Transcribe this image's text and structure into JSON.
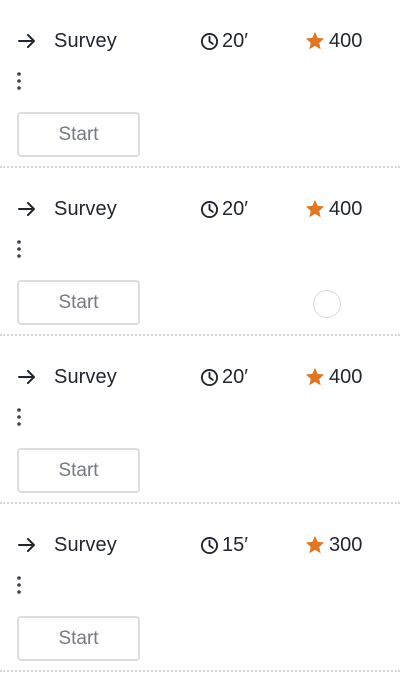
{
  "items": [
    {
      "title": "Survey",
      "duration": "20′",
      "points": "400",
      "start_label": "Start"
    },
    {
      "title": "Survey",
      "duration": "20′",
      "points": "400",
      "start_label": "Start"
    },
    {
      "title": "Survey",
      "duration": "20′",
      "points": "400",
      "start_label": "Start"
    },
    {
      "title": "Survey",
      "duration": "15′",
      "points": "300",
      "start_label": "Start"
    }
  ],
  "icons": {
    "arrow": "arrow-right-icon",
    "clock": "clock-icon",
    "star": "star-icon",
    "more": "more-vertical-icon",
    "spinner": "loading-circle"
  },
  "colors": {
    "star": "#e07624",
    "text": "#222631",
    "button_text": "#757983",
    "button_border": "#dcdde0",
    "divider": "#d5d7dc"
  }
}
